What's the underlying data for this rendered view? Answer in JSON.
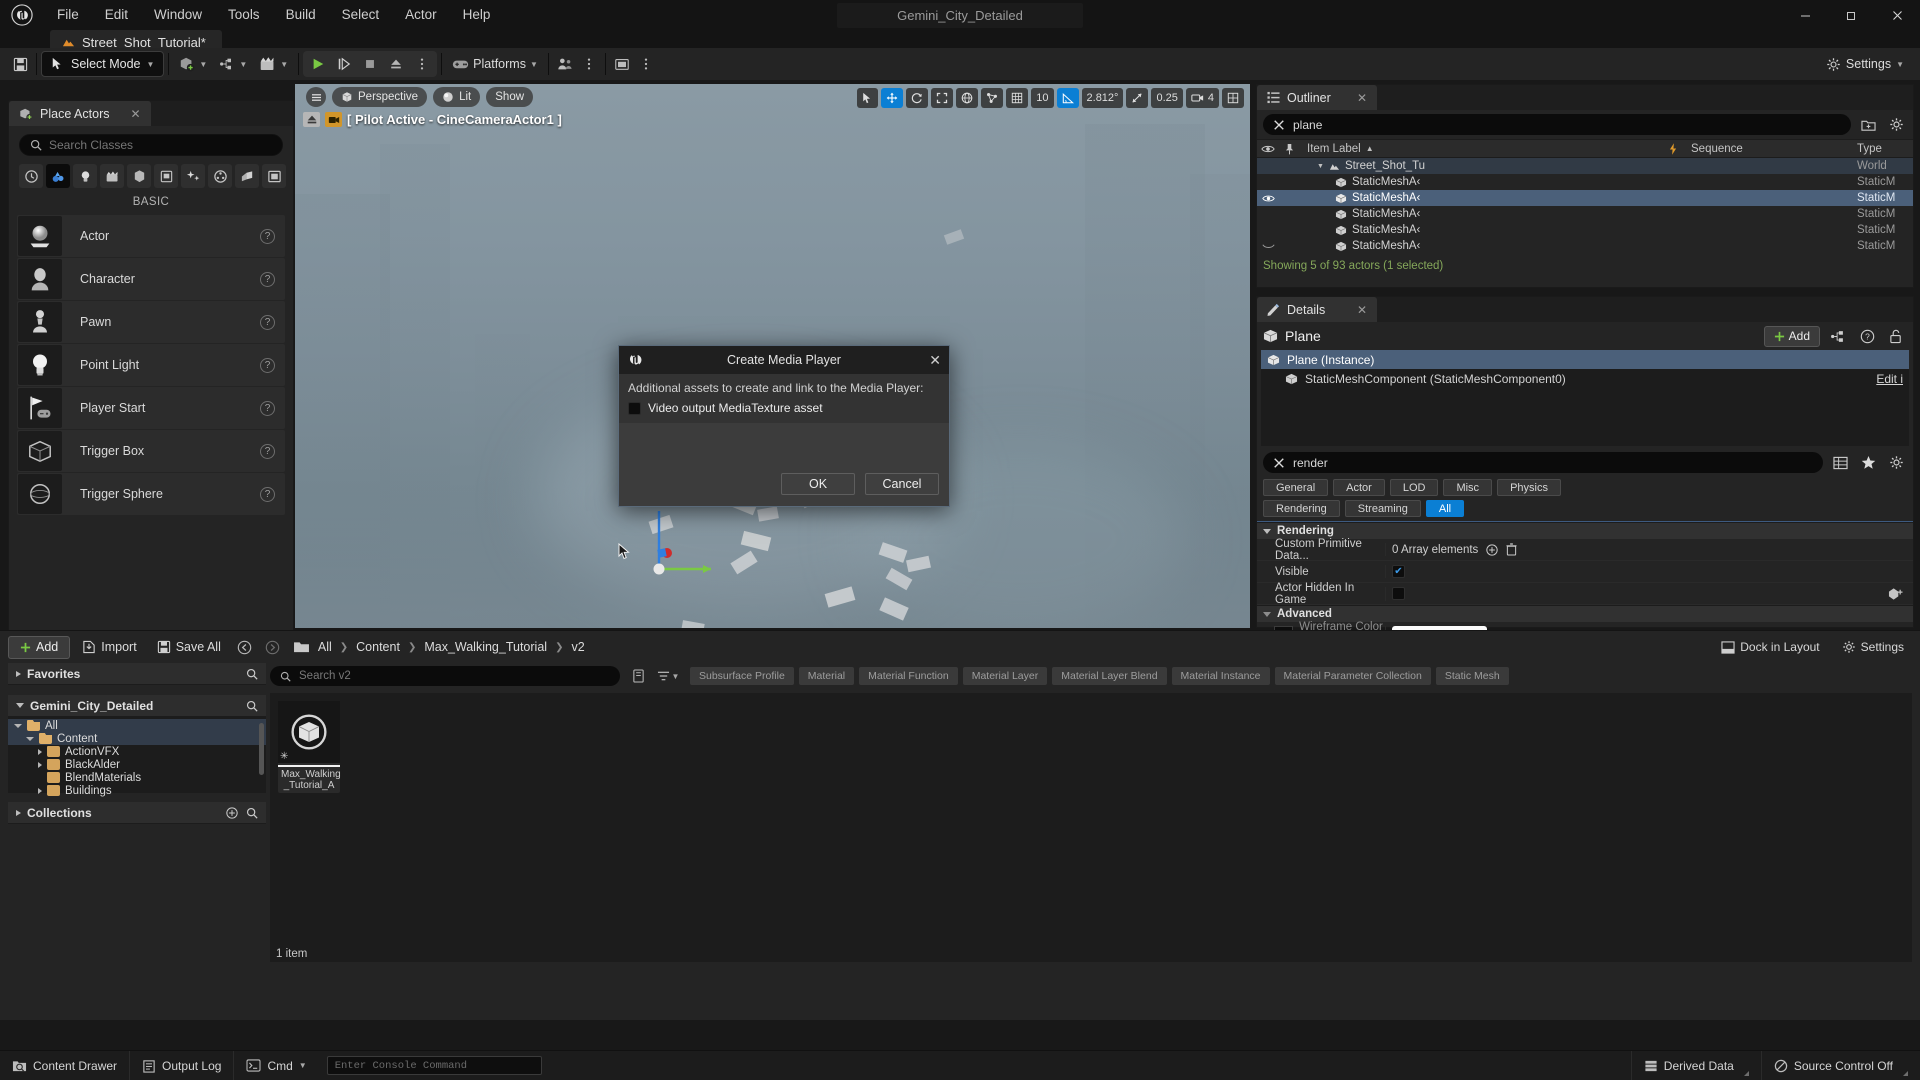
{
  "window": {
    "project_title": "Gemini_City_Detailed",
    "minimize": "—",
    "maximize": "❐",
    "close": "✕"
  },
  "menu": {
    "items": [
      "File",
      "Edit",
      "Window",
      "Tools",
      "Build",
      "Select",
      "Actor",
      "Help"
    ]
  },
  "level_tab": {
    "label": "Street_Shot_Tutorial*"
  },
  "toolbar": {
    "save_icon": "save-icon",
    "mode_label": "Select Mode",
    "platforms_label": "Platforms",
    "settings_label": "Settings"
  },
  "place_actors": {
    "tab_label": "Place Actors",
    "close": "✕",
    "search_placeholder": "Search Classes",
    "category_label": "BASIC",
    "categories": [
      "recently-placed-icon",
      "basic-icon",
      "lights-icon",
      "cinematic-icon",
      "visual-effects-icon",
      "volumes-icon",
      "all-classes-icon",
      "shapes-icon",
      "geometry-icon",
      "ui-icon"
    ],
    "actors": [
      {
        "name": "Actor",
        "help": "?"
      },
      {
        "name": "Character",
        "help": "?"
      },
      {
        "name": "Pawn",
        "help": "?"
      },
      {
        "name": "Point Light",
        "help": "?"
      },
      {
        "name": "Player Start",
        "help": "?"
      },
      {
        "name": "Trigger Box",
        "help": "?"
      },
      {
        "name": "Trigger Sphere",
        "help": "?"
      }
    ]
  },
  "viewport": {
    "menu_icon": "hamburger-icon",
    "perspective": "Perspective",
    "lit": "Lit",
    "show": "Show",
    "pilot_text": "[ Pilot Active - CineCameraActor1 ]",
    "grid_snap_value": "10",
    "rotation_snap_value": "2.812°",
    "scale_snap_value": "0.25",
    "camera_speed_value": "4"
  },
  "dialog": {
    "title": "Create Media Player",
    "close": "✕",
    "description": "Additional assets to create and link to the Media Player:",
    "checkbox_label": "Video output MediaTexture asset",
    "checkbox_checked": false,
    "ok_label": "OK",
    "cancel_label": "Cancel"
  },
  "outliner": {
    "tab_label": "Outliner",
    "close": "✕",
    "search_value": "plane",
    "columns": {
      "label": "Item Label",
      "sequence": "Sequence",
      "type": "Type"
    },
    "rows": [
      {
        "label": "Street_Shot_Tu",
        "type": "World",
        "kind": "world",
        "indent": 18,
        "selected": false,
        "eye": false
      },
      {
        "label": "StaticMeshA‹",
        "type": "StaticM",
        "kind": "mesh",
        "indent": 36,
        "selected": false,
        "eye": false
      },
      {
        "label": "StaticMeshA‹",
        "type": "StaticM",
        "kind": "mesh",
        "indent": 36,
        "selected": true,
        "eye": true
      },
      {
        "label": "StaticMeshA‹",
        "type": "StaticM",
        "kind": "mesh",
        "indent": 36,
        "selected": false,
        "eye": false
      },
      {
        "label": "StaticMeshA‹",
        "type": "StaticM",
        "kind": "mesh",
        "indent": 36,
        "selected": false,
        "eye": false
      },
      {
        "label": "StaticMeshA‹",
        "type": "StaticM",
        "kind": "mesh",
        "indent": 36,
        "selected": false,
        "eye": false
      }
    ],
    "status": "Showing 5 of 93 actors (1 selected)"
  },
  "details": {
    "tab_label": "Details",
    "close": "✕",
    "actor_name": "Plane",
    "add_label": "Add",
    "component_root": "Plane (Instance)",
    "component_child": "StaticMeshComponent (StaticMeshComponent0)",
    "edit_link": "Edit i",
    "search_value": "render",
    "filters_row1": [
      "General",
      "Actor",
      "LOD",
      "Misc",
      "Physics"
    ],
    "filters_row2": [
      "Rendering",
      "Streaming",
      "All"
    ],
    "active_filter": "All",
    "sections": [
      {
        "name": "Rendering",
        "rows": [
          {
            "name": "Custom Primitive Data...",
            "value": "0 Array elements",
            "type": "array"
          },
          {
            "name": "Visible",
            "value": "",
            "type": "checkbox",
            "checked": true
          },
          {
            "name": "Actor Hidden In Game",
            "value": "",
            "type": "checkbox",
            "checked": false
          }
        ]
      },
      {
        "name": "Advanced",
        "rows": [
          {
            "name": "Wireframe Color O...",
            "value": "",
            "type": "color"
          }
        ]
      }
    ]
  },
  "content_browser": {
    "add_label": "Add",
    "import_label": "Import",
    "save_all_label": "Save All",
    "breadcrumb": [
      "All",
      "Content",
      "Max_Walking_Tutorial",
      "v2"
    ],
    "dock_label": "Dock in Layout",
    "settings_label": "Settings",
    "favorites_label": "Favorites",
    "project_label": "Gemini_City_Detailed",
    "collections_label": "Collections",
    "tree": [
      {
        "label": "All",
        "indent": 6,
        "arrow": "open",
        "selected": true
      },
      {
        "label": "Content",
        "indent": 18,
        "arrow": "open",
        "selected": true
      },
      {
        "label": "ActionVFX",
        "indent": 30,
        "arrow": "closed",
        "selected": false
      },
      {
        "label": "BlackAlder",
        "indent": 30,
        "arrow": "closed",
        "selected": false
      },
      {
        "label": "BlendMaterials",
        "indent": 30,
        "arrow": "none",
        "selected": false
      },
      {
        "label": "Buildings",
        "indent": 30,
        "arrow": "closed",
        "selected": false
      }
    ],
    "search_placeholder": "Search v2",
    "type_filters": [
      "Subsurface Profile",
      "Material",
      "Material Function",
      "Material Layer",
      "Material Layer Blend",
      "Material Instance",
      "Material Parameter Collection",
      "Static Mesh"
    ],
    "assets": [
      {
        "name": "Max_Walking\n_Tutorial_A",
        "line1": "Max_Walking",
        "line2": "_Tutorial_A"
      }
    ],
    "item_count": "1 item"
  },
  "status_bar": {
    "content_drawer": "Content Drawer",
    "output_log": "Output Log",
    "cmd": "Cmd",
    "console_placeholder": "Enter Console Command",
    "derived_data": "Derived Data",
    "source_control": "Source Control Off"
  }
}
